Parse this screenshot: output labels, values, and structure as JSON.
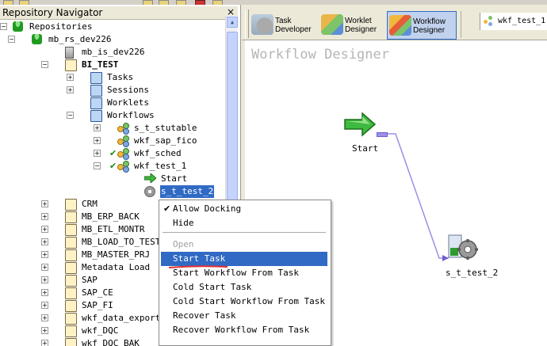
{
  "navigator": {
    "title": "Repository Navigator",
    "close": "×",
    "items": [
      {
        "label": "Repositories",
        "level": 0,
        "icon": "repository-icon",
        "expander": "-"
      },
      {
        "label": "mb_rs_dev226",
        "level": 1,
        "icon": "database-icon",
        "expander": "-"
      },
      {
        "label": "mb_is_dev226",
        "level": 2,
        "icon": "server-icon",
        "expander": ""
      },
      {
        "label": "BI_TEST",
        "level": 2,
        "icon": "folder-icon",
        "expander": "-",
        "bold": true
      },
      {
        "label": "Tasks",
        "level": 3,
        "icon": "folder-icon",
        "expander": "+"
      },
      {
        "label": "Sessions",
        "level": 3,
        "icon": "folder-icon",
        "expander": "+"
      },
      {
        "label": "Worklets",
        "level": 3,
        "icon": "folder-icon",
        "expander": ""
      },
      {
        "label": "Workflows",
        "level": 3,
        "icon": "folder-icon",
        "expander": "-"
      },
      {
        "label": "s_t_stutable",
        "level": 4,
        "icon": "workflow-icon",
        "expander": "+"
      },
      {
        "label": "wkf_sap_fico",
        "level": 4,
        "icon": "workflow-icon",
        "expander": "+"
      },
      {
        "label": "wkf_sched",
        "level": 4,
        "icon": "workflow-icon",
        "expander": "+",
        "checked": true
      },
      {
        "label": "wkf_test_1",
        "level": 4,
        "icon": "workflow-icon",
        "expander": "-",
        "checked": true
      },
      {
        "label": "Start",
        "level": 5,
        "icon": "start-icon",
        "expander": ""
      },
      {
        "label": "s_t_test_2",
        "level": 5,
        "icon": "session-icon",
        "expander": "",
        "selected": true
      },
      {
        "label": "CRM",
        "level": 2,
        "icon": "folder-icon",
        "expander": "+"
      },
      {
        "label": "MB_ERP_BACK",
        "level": 2,
        "icon": "folder-icon",
        "expander": "+"
      },
      {
        "label": "MB_ETL_MONTR",
        "level": 2,
        "icon": "folder-icon",
        "expander": "+"
      },
      {
        "label": "MB_LOAD_TO_TEST",
        "level": 2,
        "icon": "folder-icon",
        "expander": "+"
      },
      {
        "label": "MB_MASTER_PRJ",
        "level": 2,
        "icon": "folder-icon",
        "expander": "+"
      },
      {
        "label": "Metadata Load",
        "level": 2,
        "icon": "folder-icon",
        "expander": "+"
      },
      {
        "label": "SAP",
        "level": 2,
        "icon": "folder-icon",
        "expander": "+"
      },
      {
        "label": "SAP_CE",
        "level": 2,
        "icon": "folder-icon",
        "expander": "+"
      },
      {
        "label": "SAP_FI",
        "level": 2,
        "icon": "folder-icon",
        "expander": "+"
      },
      {
        "label": "wkf_data_export",
        "level": 2,
        "icon": "folder-icon",
        "expander": "+"
      },
      {
        "label": "wkf_DQC",
        "level": 2,
        "icon": "folder-icon",
        "expander": "+"
      },
      {
        "label": "wkf_DQC_BAK",
        "level": 2,
        "icon": "folder-icon",
        "expander": "+"
      }
    ]
  },
  "toolbar": {
    "task_developer": {
      "line1": "Task",
      "line2": "Developer"
    },
    "worklet_designer": {
      "line1": "Worklet",
      "line2": "Designer"
    },
    "workflow_designer": {
      "line1": "Workflow",
      "line2": "Designer"
    },
    "open_tab": "wkf_test_1"
  },
  "canvas": {
    "title": "Workflow Designer",
    "start_label": "Start",
    "task_label": "s_t_test_2"
  },
  "context_menu": {
    "items": [
      {
        "label": "Allow Docking",
        "checked": true
      },
      {
        "label": "Hide"
      },
      {
        "separator": true
      },
      {
        "label": "Open",
        "disabled": true
      },
      {
        "label": "Start Task",
        "highlighted": true
      },
      {
        "label": "Start Workflow From Task"
      },
      {
        "label": "Cold Start Task"
      },
      {
        "label": "Cold Start Workflow From Task"
      },
      {
        "label": "Recover Task"
      },
      {
        "label": "Recover Workflow From Task"
      }
    ],
    "check_mark": "✔"
  },
  "colors": {
    "selection": "#316ac5",
    "connector": "#9c8fe6",
    "annotation_underline": "#e23030"
  }
}
